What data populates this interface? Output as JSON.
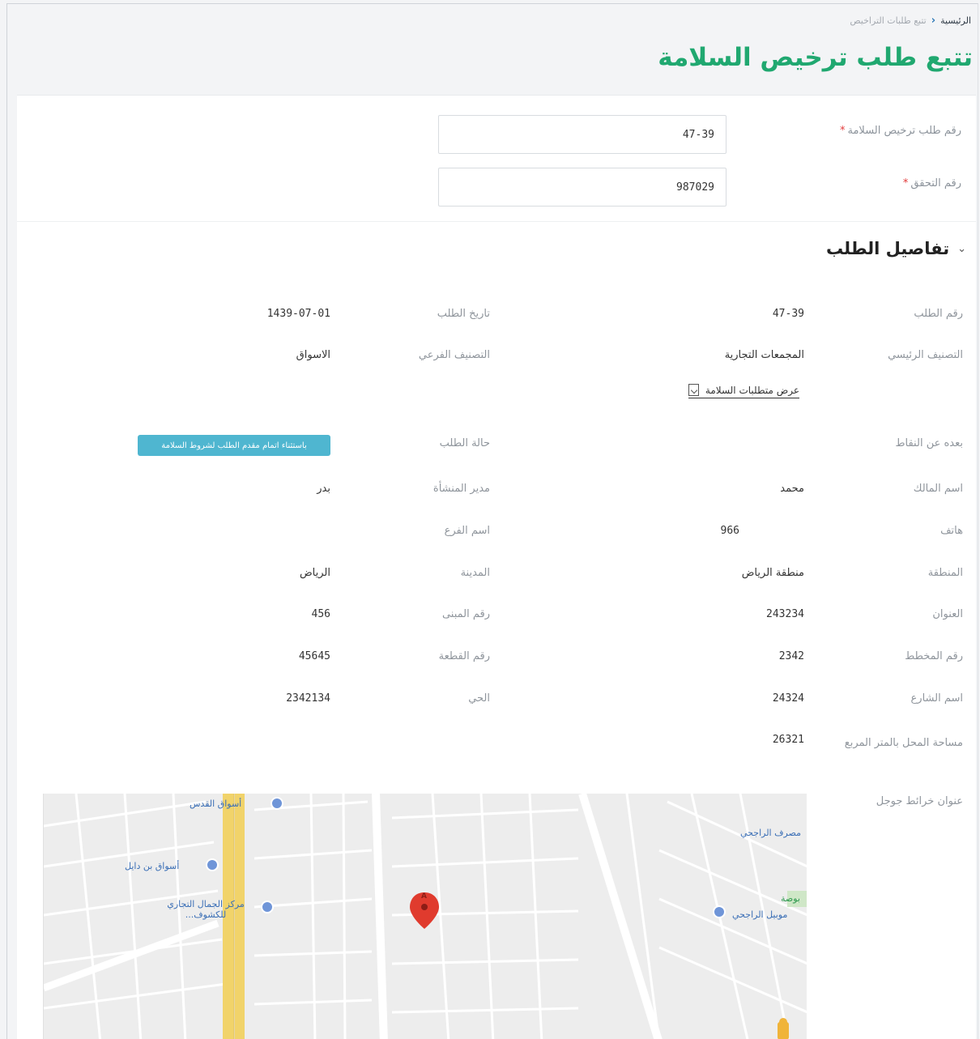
{
  "breadcrumb": {
    "home": "الرئيسية",
    "separator": "‹",
    "current": "تتبع طلبات التراخيص"
  },
  "page_title": "تتبع طلب ترخيص السلامة",
  "search": {
    "license_label": "رقم طلب ترخيص السلامة",
    "license_value": "47-39",
    "verify_label": "رقم التحقق",
    "verify_value": "987029",
    "required_mark": "*"
  },
  "details": {
    "section_title": "تفاصيل الطلب",
    "right": [
      {
        "label": "رقم الطلب",
        "value": "47-39"
      },
      {
        "label": "التصنيف الرئيسي",
        "value": "المجمعات التجارية"
      },
      {
        "label": "بعده عن النقاط",
        "value": ""
      },
      {
        "label": "اسم المالك",
        "value": "محمد"
      },
      {
        "label": "هاتف",
        "value": "966"
      },
      {
        "label": "المنطقة",
        "value": "منطقة الرياض"
      },
      {
        "label": "العنوان",
        "value": "243234"
      },
      {
        "label": "رقم المخطط",
        "value": "2342"
      },
      {
        "label": "اسم الشارع",
        "value": "24324"
      },
      {
        "label": "مساحة المحل بالمتر المربع",
        "value": "26321"
      },
      {
        "label": "عنوان خرائط جوجل",
        "value": ""
      }
    ],
    "left": [
      {
        "label": "تاريخ الطلب",
        "value": "1439-07-01"
      },
      {
        "label": "التصنيف الفرعي",
        "value": "الاسواق"
      },
      {
        "label": "حالة الطلب",
        "value": "باستثناء اتمام مقدم الطلب لشروط السلامة"
      },
      {
        "label": "مدير المنشأة",
        "value": "بدر"
      },
      {
        "label": "اسم الفرع",
        "value": ""
      },
      {
        "label": "المدينة",
        "value": "الرياض"
      },
      {
        "label": "رقم المبنى",
        "value": "456"
      },
      {
        "label": "رقم القطعة",
        "value": "45645"
      },
      {
        "label": "الحي",
        "value": "2342134"
      }
    ],
    "requirements_link": "عرض متطلبات السلامة"
  },
  "map": {
    "pois": [
      {
        "name": "أسواق القدس"
      },
      {
        "name": "أسواق بن دايل"
      },
      {
        "name": "مركز الجمال التجاري للكشوف..."
      },
      {
        "name": "مصرف الراجحي"
      },
      {
        "name": "موبيل الراجحي"
      },
      {
        "name": "بوصة"
      }
    ],
    "marker_letter": "A",
    "colors": {
      "road_major": "#f1d36a",
      "road": "#ffffff",
      "background": "#ededed",
      "marker": "#e03b2e"
    }
  }
}
